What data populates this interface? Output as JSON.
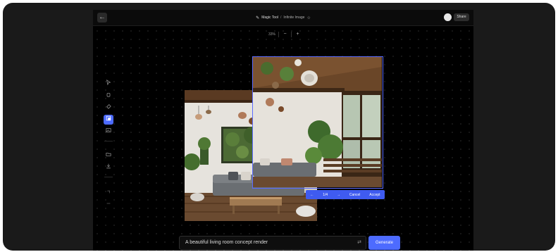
{
  "header": {
    "tool_name": "Magic Tool",
    "separator": "/",
    "doc_name": "Infinite Image",
    "share_label": "Share"
  },
  "zoom": {
    "value": "33%",
    "minus_label": "−",
    "plus_label": "+"
  },
  "toolbar": {
    "active_tool": "outpaint",
    "tools": [
      "pointer",
      "hand",
      "eraser",
      "outpaint",
      "image",
      "folder",
      "download",
      "undo",
      "redo"
    ]
  },
  "selection_actions": {
    "prev": "←",
    "counter": "1/4",
    "next": "→",
    "cancel": "Cancel",
    "accept": "Accept"
  },
  "prompt": {
    "value": "A beautiful living room concept render"
  },
  "generate_label": "Generate",
  "colors": {
    "accent": "#4d6bff",
    "background": "#000000"
  }
}
